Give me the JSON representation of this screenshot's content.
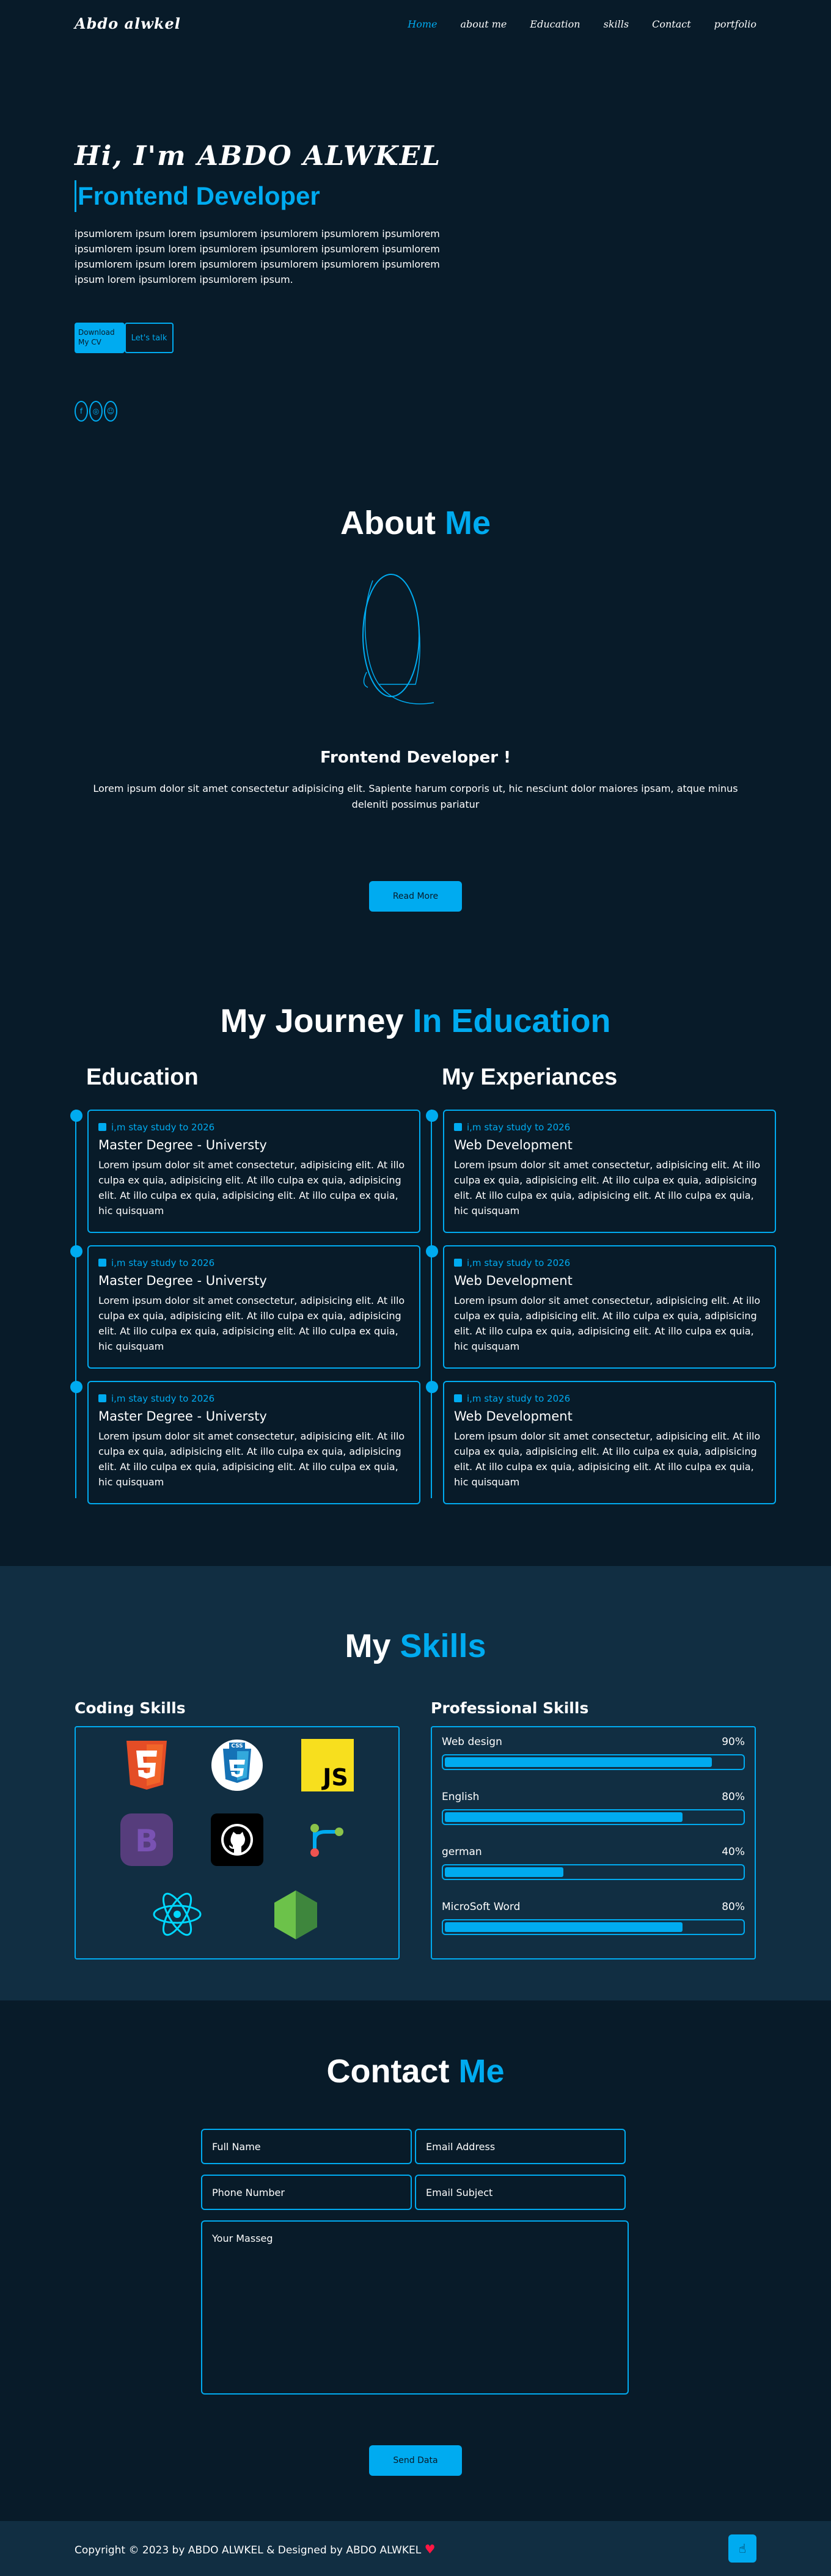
{
  "header": {
    "logo": "Abdo alwkel",
    "nav": [
      "Home",
      "about me",
      "Education",
      "skills",
      "Contact",
      "portfolio"
    ]
  },
  "hero": {
    "title": "Hi, I'm ABDO ALWKEL",
    "role": "Frontend Developer",
    "text": "ipsumlorem ipsum lorem ipsumlorem ipsumlorem ipsumlorem ipsumlorem ipsumlorem ipsum lorem ipsumlorem ipsumlorem ipsumlorem ipsumlorem ipsumlorem ipsum lorem ipsumlorem ipsumlorem ipsumlorem ipsumlorem ipsum lorem ipsumlorem ipsumlorem ipsum.",
    "btn_cv": "Download My CV",
    "btn_talk": "Let's talk",
    "socials": [
      "facebook-icon",
      "instagram-icon",
      "github-icon"
    ]
  },
  "about": {
    "title_a": "About",
    "title_b": "Me",
    "subtitle": "Frontend Developer !",
    "text": "Lorem ipsum dolor sit amet consectetur adipisicing elit. Sapiente harum corporis ut, hic nesciunt dolor maiores ipsam, atque minus deleniti possimus pariatur",
    "btn": "Read More"
  },
  "education": {
    "title_a": "My Journey",
    "title_b": "In Education",
    "col_edu": "Education",
    "col_exp": "My Experiances",
    "edu_items": [
      {
        "date": "i,m stay study to 2026",
        "title": "Master Degree - Universty",
        "text": "Lorem ipsum dolor sit amet consectetur, adipisicing elit. At illo culpa ex quia, adipisicing elit. At illo culpa ex quia, adipisicing elit. At illo culpa ex quia, adipisicing elit. At illo culpa ex quia, hic quisquam"
      },
      {
        "date": "i,m stay study to 2026",
        "title": "Master Degree - Universty",
        "text": "Lorem ipsum dolor sit amet consectetur, adipisicing elit. At illo culpa ex quia, adipisicing elit. At illo culpa ex quia, adipisicing elit. At illo culpa ex quia, adipisicing elit. At illo culpa ex quia, hic quisquam"
      },
      {
        "date": "i,m stay study to 2026",
        "title": "Master Degree - Universty",
        "text": "Lorem ipsum dolor sit amet consectetur, adipisicing elit. At illo culpa ex quia, adipisicing elit. At illo culpa ex quia, adipisicing elit. At illo culpa ex quia, adipisicing elit. At illo culpa ex quia, hic quisquam"
      }
    ],
    "exp_items": [
      {
        "date": "i,m stay study to 2026",
        "title": "Web Development",
        "text": "Lorem ipsum dolor sit amet consectetur, adipisicing elit. At illo culpa ex quia, adipisicing elit. At illo culpa ex quia, adipisicing elit. At illo culpa ex quia, adipisicing elit. At illo culpa ex quia, hic quisquam"
      },
      {
        "date": "i,m stay study to 2026",
        "title": "Web Development",
        "text": "Lorem ipsum dolor sit amet consectetur, adipisicing elit. At illo culpa ex quia, adipisicing elit. At illo culpa ex quia, adipisicing elit. At illo culpa ex quia, adipisicing elit. At illo culpa ex quia, hic quisquam"
      },
      {
        "date": "i,m stay study to 2026",
        "title": "Web Development",
        "text": "Lorem ipsum dolor sit amet consectetur, adipisicing elit. At illo culpa ex quia, adipisicing elit. At illo culpa ex quia, adipisicing elit. At illo culpa ex quia, adipisicing elit. At illo culpa ex quia, hic quisquam"
      }
    ]
  },
  "skills": {
    "title_a": "My",
    "title_b": "Skills",
    "coding_title": "Coding Skills",
    "professional_title": "Professional Skills",
    "coding_icons": [
      "html5-icon",
      "css3-icon",
      "javascript-icon",
      "bootstrap-icon",
      "github-icon",
      "git-icon",
      "react-icon",
      "nodejs-icon"
    ],
    "icon_labels": {
      "css": "CSS",
      "js": "JS",
      "bootstrap": "B"
    },
    "professional": [
      {
        "name": "Web design",
        "percent": "90%",
        "level": 0.9
      },
      {
        "name": "English",
        "percent": "80%",
        "level": 0.8
      },
      {
        "name": "german",
        "percent": "40%",
        "level": 0.4
      },
      {
        "name": "MicroSoft Word",
        "percent": "80%",
        "level": 0.8
      }
    ]
  },
  "contact": {
    "title_a": "Contact",
    "title_b": "Me",
    "full_name": "Full Name",
    "email": "Email Address",
    "phone": "Phone Number",
    "subject": "Email Subject",
    "message": "Your Masseg",
    "btn": "Send Data"
  },
  "footer": {
    "text": "Copyright © 2023 by ABDO ALWKEL & Designed by ABDO ALWKEL",
    "heart": "♥",
    "to_top_icon": "hand-pointer-icon"
  },
  "colors": {
    "background": "#081b29",
    "accent": "#00abf0",
    "panel": "#112e42"
  }
}
